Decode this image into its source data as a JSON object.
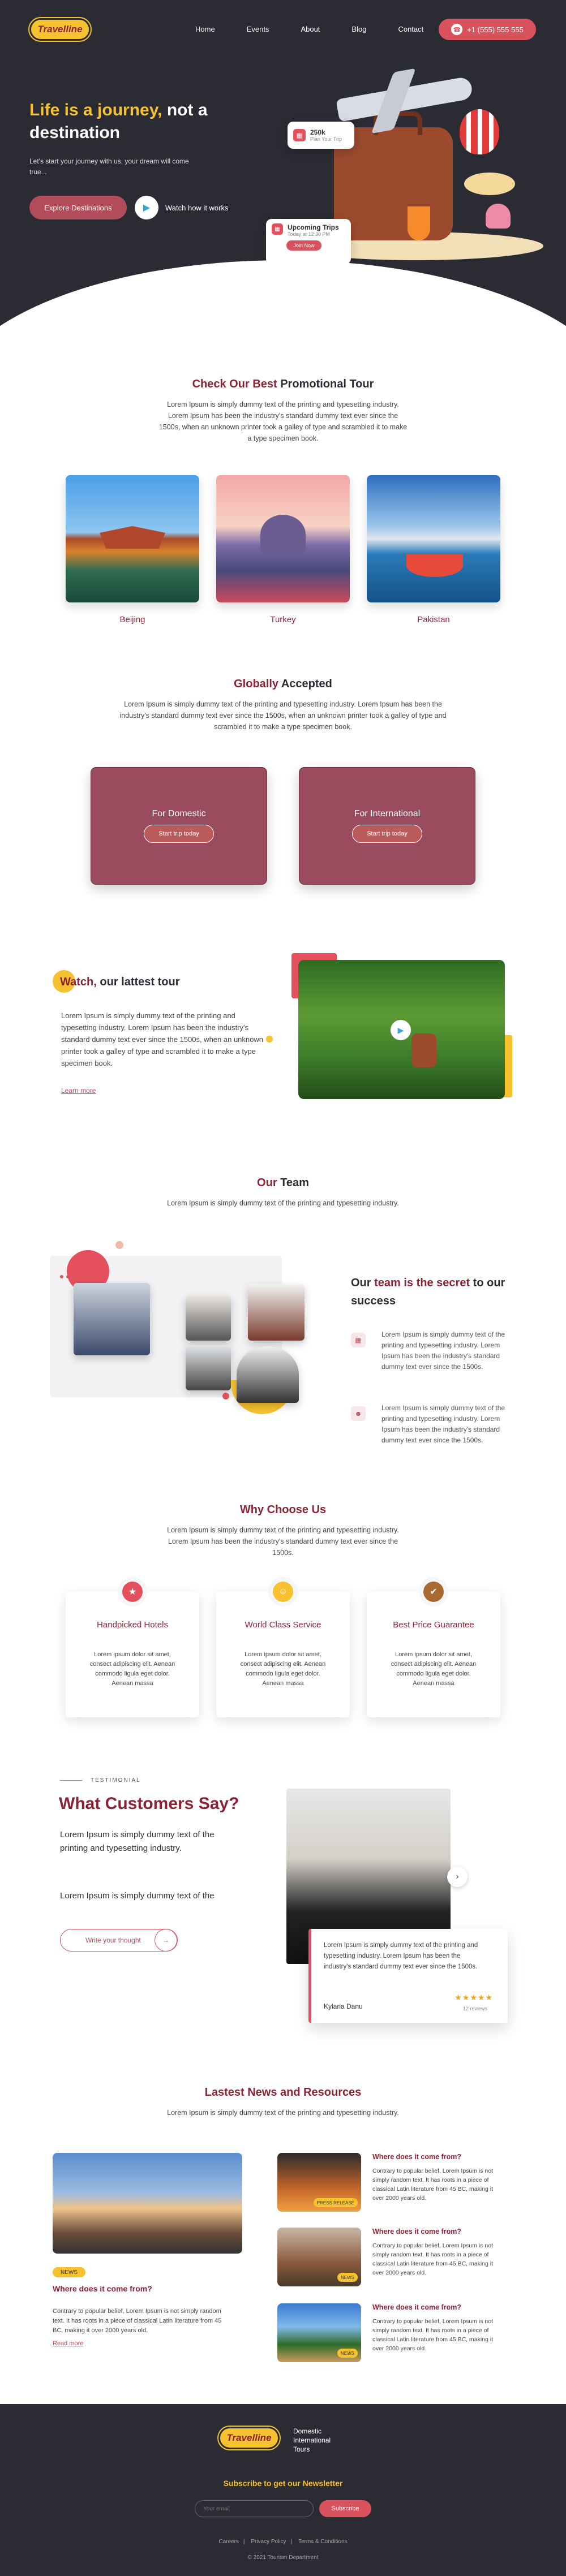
{
  "brand": {
    "logo": "Travelline"
  },
  "nav": {
    "links": [
      "Home",
      "Events",
      "About",
      "Blog",
      "Contact"
    ],
    "phone": "+1 (555) 555 555"
  },
  "hero": {
    "title_hl": "Life is a journey,",
    "title_rest": " not a destination",
    "subtitle": "Let's start your journey with us, your dream will come true...",
    "explore": "Explore Destinations",
    "watch": "Watch how it works",
    "card_a": {
      "title": "250k",
      "sub": "Plan Your Trip"
    },
    "card_b": {
      "title": "Upcoming Trips",
      "sub": "Today at 12:30 PM",
      "btn": "Join Now"
    }
  },
  "promo": {
    "title_hl": "Check Our Best",
    "title_rest": " Promotional Tour",
    "desc": "Lorem Ipsum is simply dummy text of the printing and typesetting industry. Lorem Ipsum has been the industry's standard dummy text ever since the 1500s, when an unknown printer took a galley of type and scrambled it to make a type specimen book.",
    "cards": [
      "Beijing",
      "Turkey",
      "Pakistan"
    ]
  },
  "global": {
    "title_hl": "Globally",
    "title_rest": " Accepted",
    "desc": "Lorem Ipsum is simply dummy text of the printing and typesetting industry. Lorem Ipsum has been the industry's standard dummy text ever since the 1500s, when an unknown printer took a galley of type and scrambled it to make a type specimen book.",
    "domestic": "For Domestic",
    "international": "For International",
    "btn": "Start trip today"
  },
  "watch_sec": {
    "title_hl": "Watch,",
    "title_rest": " our lattest tour",
    "text": "Lorem Ipsum is simply dummy text of the printing and typesetting industry. Lorem Ipsum has been the industry's standard dummy text ever since the 1500s, when an unknown printer took a galley of type and scrambled it to make a type specimen book.",
    "learn": "Learn more"
  },
  "team": {
    "title_hl": "Our",
    "title_rest": " Team",
    "desc": "Lorem Ipsum is simply dummy text of the printing and typesetting industry.",
    "right_a": "Our ",
    "right_hl": "team is the secret",
    "right_b": " to our success",
    "item1": "Lorem Ipsum is simply dummy text of the printing and typesetting industry. Lorem Ipsum has been the industry's standard dummy text ever since the 1500s.",
    "item2": "Lorem Ipsum is simply dummy text of the printing and typesetting industry. Lorem Ipsum has been the industry's standard dummy text ever since the 1500s."
  },
  "why": {
    "title": "Why Choose Us",
    "desc": "Lorem Ipsum is simply dummy text of the printing and typesetting industry. Lorem Ipsum has been the industry's standard dummy text ever since the 1500s.",
    "cards": [
      {
        "title": "Handpicked Hotels",
        "text": "Lorem ipsum dolor sit amet, consect adipiscing elit. Aenean commodo ligula eget dolor. Aenean massa",
        "color": "#e5505e"
      },
      {
        "title": "World Class Service",
        "text": "Lorem ipsum dolor sit amet, consect adipiscing elit. Aenean commodo ligula eget dolor. Aenean massa",
        "color": "#f6c230"
      },
      {
        "title": "Best Price Guarantee",
        "text": "Lorem ipsum dolor sit amet, consect adipiscing elit. Aenean commodo ligula eget dolor. Aenean massa",
        "color": "#a86a30"
      }
    ]
  },
  "testimonial": {
    "kicker": "TESTIMONIAL",
    "title": "What Customers Say?",
    "text1": "Lorem Ipsum is simply dummy text of the printing and typesetting industry.",
    "text2": "Lorem Ipsum is simply dummy text of the",
    "btn": "Write your thought",
    "quote": "Lorem Ipsum is simply dummy text of the printing and typesetting industry. Lorem Ipsum has been the industry's standard dummy text ever since the 1500s.",
    "name": "Kylaria Danu",
    "stars": "★★★★★",
    "reviews": "12 reviews"
  },
  "news": {
    "title": "Lastest News and Resources",
    "desc": "Lorem Ipsum is simply dummy text of the printing and typesetting industry.",
    "main": {
      "badge": "NEWS",
      "title": "Where does it come from?",
      "text": "Contrary to popular belief, Lorem Ipsum is not simply random text. It has roots in a piece of classical Latin literature from 45 BC, making it over 2000 years old.",
      "read": "Read more"
    },
    "items": [
      {
        "title": "Where does it come from?",
        "badge": "PRESS RELEASE",
        "text": "Contrary to popular belief, Lorem Ipsum is not simply random text. It has roots in a piece of classical Latin literature from 45 BC, making it over 2000 years old."
      },
      {
        "title": "Where does it come from?",
        "badge": "NEWS",
        "text": "Contrary to popular belief, Lorem Ipsum is not simply random text. It has roots in a piece of classical Latin literature from 45 BC, making it over 2000 years old."
      },
      {
        "title": "Where does it come from?",
        "badge": "NEWS",
        "text": "Contrary to popular belief, Lorem Ipsum is not simply random text. It has roots in a piece of classical Latin literature from 45 BC, making it over 2000 years old."
      }
    ]
  },
  "footer": {
    "links": [
      "Domestic",
      "International",
      "Tours"
    ],
    "subscribe": "Subscribe to get our Newsletter",
    "placeholder": "Your email",
    "btn": "Subscribe",
    "nav": [
      "Careers",
      "Privacy Policy",
      "Terms & Conditions"
    ],
    "copy": "© 2021 Tourism Department"
  }
}
